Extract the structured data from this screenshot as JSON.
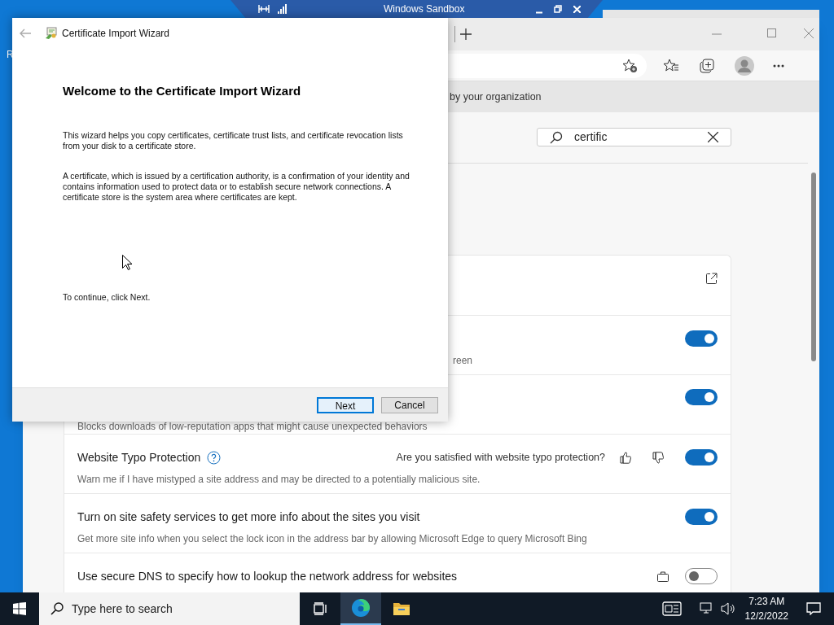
{
  "desktop": {
    "icon_label": "R"
  },
  "sandbox_bar": {
    "title": "Windows Sandbox"
  },
  "browser": {
    "info_bar": "by your organization",
    "search": {
      "value": "certific"
    },
    "settings": [
      {
        "kind": "link"
      },
      {
        "kind": "toggle",
        "description": "reen",
        "on": true
      },
      {
        "kind": "toggle",
        "description": "Blocks downloads of low-reputation apps that might cause unexpected behaviors",
        "on": true
      },
      {
        "kind": "toggle",
        "title": "Website Typo Protection",
        "help": true,
        "feedback": "Are you satisfied with website typo protection?",
        "description": "Warn me if I have mistyped a site address and may be directed to a potentially malicious site.",
        "on": true
      },
      {
        "kind": "toggle",
        "title": "Turn on site safety services to get more info about the sites you visit",
        "description": "Get more site info when you select the lock icon in the address bar by allowing Microsoft Edge to query Microsoft Bing",
        "on": true
      },
      {
        "kind": "toggle",
        "title": "Use secure DNS to specify how to lookup the network address for websites",
        "managed": true,
        "on": false
      }
    ]
  },
  "wizard": {
    "title": "Certificate Import Wizard",
    "heading": "Welcome to the Certificate Import Wizard",
    "paragraphs": [
      "This wizard helps you copy certificates, certificate trust lists, and certificate revocation lists from your disk to a certificate store.",
      "A certificate, which is issued by a certification authority, is a confirmation of your identity and contains information used to protect data or to establish secure network connections. A certificate store is the system area where certificates are kept.",
      "To continue, click Next."
    ],
    "buttons": [
      {
        "label": "Next",
        "default": true
      },
      {
        "label": "Cancel",
        "default": false
      }
    ]
  },
  "taskbar": {
    "search_placeholder": "Type here to search",
    "apps": [
      {
        "kind": "task-view",
        "selected": false
      },
      {
        "kind": "edge",
        "selected": true
      },
      {
        "kind": "explorer",
        "selected": false
      }
    ],
    "time": "7:23 AM",
    "date": "12/2/2022"
  }
}
